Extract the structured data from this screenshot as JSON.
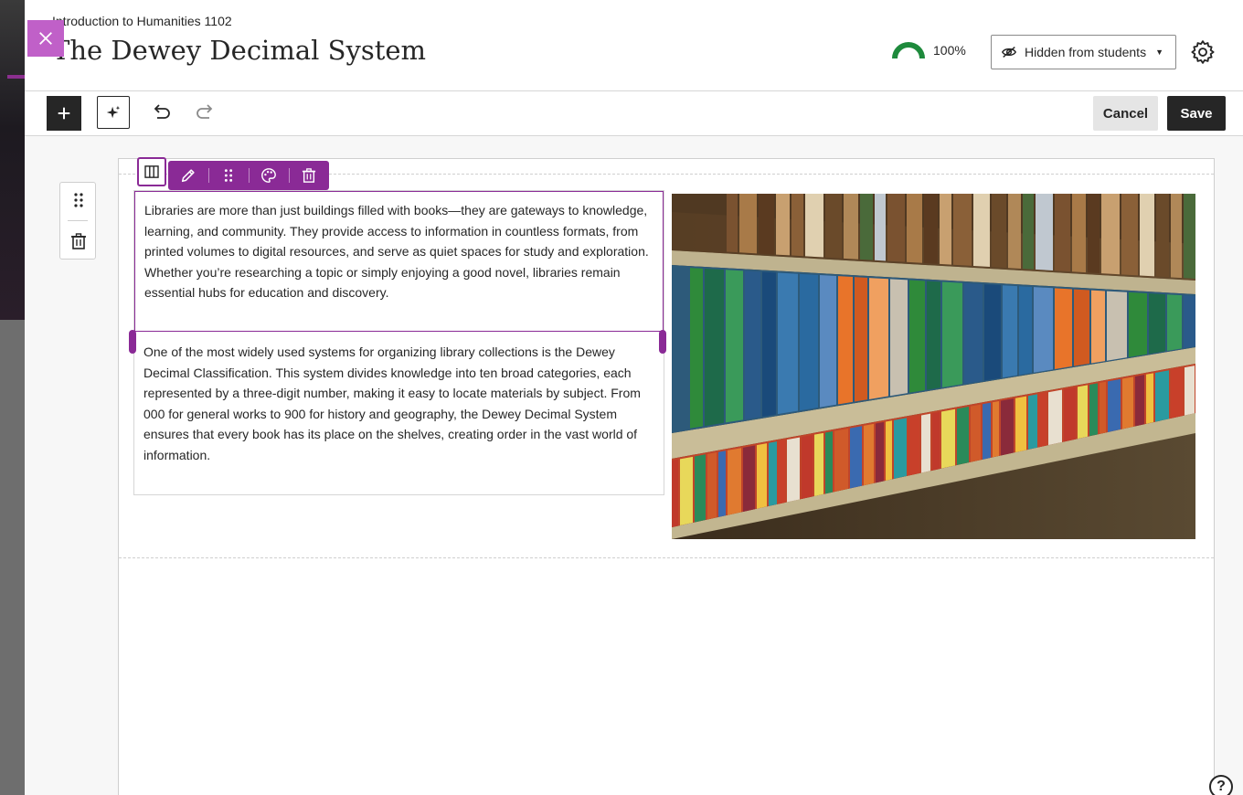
{
  "header": {
    "course_name": "Introduction to Humanities 1102",
    "page_title": "The Dewey Decimal System",
    "progress_label": "100%",
    "progress_value": 1.0,
    "visibility_label": "Hidden from students"
  },
  "toolbar": {
    "cancel_label": "Cancel",
    "save_label": "Save"
  },
  "content": {
    "paragraphs": [
      "Libraries are more than just buildings filled with books—they are gateways to knowledge, learning, and community. They provide access to information in countless formats, from printed volumes to digital resources, and serve as quiet spaces for study and exploration. Whether you’re researching a topic or simply enjoying a good novel, libraries remain essential hubs for education and discovery.",
      "One of the most widely used systems for organizing library collections is the Dewey Decimal Classification. This system divides knowledge into ten broad categories, each represented by a three-digit number, making it easy to locate materials by subject. From 000 for general works to 900 for history and geography, the Dewey Decimal System ensures that every book has its place on the shelves, creating order in the vast world of information."
    ]
  },
  "help_label": "?",
  "icons": {
    "close": "close-icon",
    "progress": "progress-gauge-icon",
    "visibility": "eye-slash-icon",
    "settings": "gear-icon",
    "add": "plus-icon",
    "ai": "sparkle-icon",
    "undo": "undo-icon",
    "redo": "redo-icon",
    "layout": "columns-icon",
    "edit": "pencil-icon",
    "drag": "drag-handle-icon",
    "style": "palette-icon",
    "delete": "trash-icon"
  },
  "colors": {
    "accent": "#8a2a96",
    "progress": "#1e8a3c",
    "close_button": "#c060c8",
    "primary_button": "#262626"
  }
}
